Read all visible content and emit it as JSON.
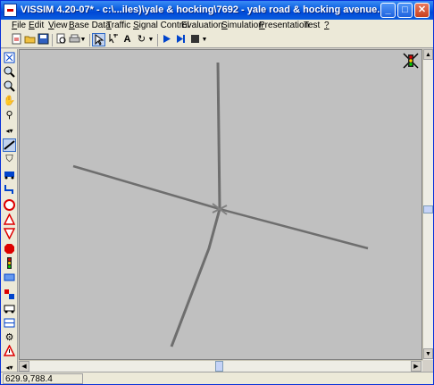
{
  "window": {
    "title": "VISSIM 4.20-07* - c:\\...iles)\\yale & hocking\\7692 - yale road & hocking avenue.inp",
    "minimize_glyph": "_",
    "maximize_glyph": "□",
    "close_glyph": "✕"
  },
  "menu": [
    {
      "label": "File",
      "u": "F",
      "rest": "ile"
    },
    {
      "label": "Edit",
      "u": "E",
      "rest": "dit"
    },
    {
      "label": "View",
      "u": "V",
      "rest": "iew"
    },
    {
      "label": "Base Data",
      "u": "B",
      "rest": "ase Data"
    },
    {
      "label": "Traffic",
      "u": "T",
      "rest": "raffic"
    },
    {
      "label": "Signal Control",
      "u": "S",
      "rest": "ignal Control"
    },
    {
      "label": "Evaluation",
      "u": "",
      "rest": "Evaluation"
    },
    {
      "label": "Simulation",
      "u": "S",
      "rest": "imulation"
    },
    {
      "label": "Presentation",
      "u": "P",
      "rest": "resentation"
    },
    {
      "label": "Test",
      "u": "",
      "rest": "Test"
    },
    {
      "label": "?",
      "u": "?",
      "rest": ""
    }
  ],
  "toolbar": {
    "icons": [
      "new-file-icon",
      "open-folder-icon",
      "save-icon",
      "print-preview-icon",
      "print-icon",
      "select-cursor-icon",
      "zoom-cursor-icon",
      "text-icon",
      "rotate-icon",
      "play-icon",
      "step-icon",
      "stop-icon"
    ]
  },
  "palette": {
    "icons": [
      "zoom-fit-icon",
      "zoom-in-icon",
      "zoom-out-icon",
      "pan-hand-icon",
      "rotate-view-icon",
      "scroll-arrows-icon",
      "links-icon",
      "vehicle-input-icon",
      "bus-icon",
      "route-icon",
      "speed-limit-icon",
      "reduced-speed-icon",
      "priority-rule-icon",
      "stop-sign-icon",
      "signal-head-icon",
      "detector-icon",
      "transit-stop-icon",
      "transit-line-icon",
      "node-icon",
      "data-collection-icon",
      "warning-icon",
      "scroll-icon"
    ]
  },
  "status": {
    "coordinates": "629.9,788.4"
  }
}
